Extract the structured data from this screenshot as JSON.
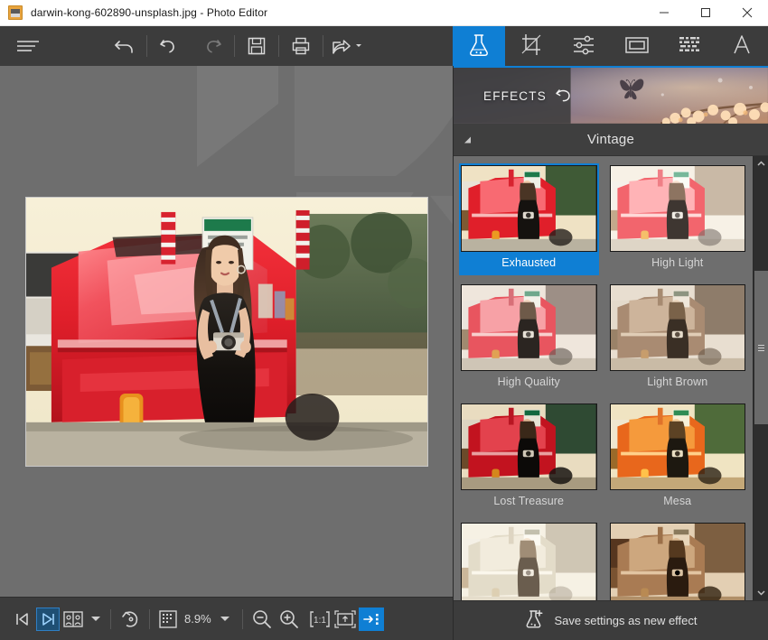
{
  "window": {
    "title": "darwin-kong-602890-unsplash.jpg - Photo Editor",
    "file_name": "darwin-kong-602890-unsplash.jpg",
    "app_name": "Photo Editor",
    "icon": "image-file-icon",
    "controls": {
      "minimize": "minimize-icon",
      "maximize": "maximize-icon",
      "close": "close-icon"
    }
  },
  "toolbar": {
    "menu": "hamburger-menu-icon",
    "revert": "revert-icon",
    "undo": "undo-icon",
    "redo": "redo-icon",
    "save": "save-icon",
    "print": "print-icon",
    "share": "share-icon"
  },
  "tabs": [
    {
      "id": "effects",
      "icon": "flask-icon",
      "active": true
    },
    {
      "id": "crop",
      "icon": "crop-icon",
      "active": false
    },
    {
      "id": "adjust",
      "icon": "sliders-icon",
      "active": false
    },
    {
      "id": "frame",
      "icon": "frame-icon",
      "active": false
    },
    {
      "id": "texture",
      "icon": "texture-icon",
      "active": false
    },
    {
      "id": "text",
      "icon": "text-icon",
      "active": false
    }
  ],
  "effects_panel": {
    "banner_label": "EFFECTS",
    "banner_reset_icon": "reset-arrow-icon",
    "category": {
      "name": "Vintage",
      "collapse_icon": "collapse-triangle-icon",
      "expanded": true
    },
    "items": [
      {
        "label": "Exhausted",
        "selected": true,
        "style": "red-warm"
      },
      {
        "label": "High Light",
        "selected": false,
        "style": "pale-red"
      },
      {
        "label": "High Quality",
        "selected": false,
        "style": "muted-pink"
      },
      {
        "label": "Light Brown",
        "selected": false,
        "style": "brown"
      },
      {
        "label": "Lost Treasure",
        "selected": false,
        "style": "deep-red"
      },
      {
        "label": "Mesa",
        "selected": false,
        "style": "orange"
      },
      {
        "label": "",
        "selected": false,
        "style": "pale-sepia"
      },
      {
        "label": "",
        "selected": false,
        "style": "dark-sepia"
      }
    ],
    "save_effect_label": "Save settings as new effect",
    "save_effect_icon": "flask-plus-icon",
    "scrollbar": {
      "up_icon": "chevron-up-icon",
      "down_icon": "chevron-down-icon"
    }
  },
  "statusbar": {
    "first_image_icon": "previous-image-icon",
    "next_image_icon": "next-image-icon",
    "compare_icon": "compare-view-icon",
    "compare_dropdown_icon": "chevron-down-icon",
    "rotate_icon": "rotate-icon",
    "resolution_icon": "resolution-icon",
    "zoom_value": "8.9%",
    "zoom_dropdown_icon": "chevron-down-icon",
    "zoom_out_icon": "zoom-out-icon",
    "zoom_in_icon": "zoom-in-icon",
    "actual_size_icon": "actual-size-icon",
    "fit_window_icon": "fit-to-window-icon",
    "toggle_panel_icon": "toggle-panel-icon"
  },
  "colors": {
    "accent": "#0f7fd4",
    "chrome": "#3c3c3c",
    "canvas": "#6e6e6e",
    "titlebar": "#ffffff",
    "text": "#e0e0e0"
  }
}
